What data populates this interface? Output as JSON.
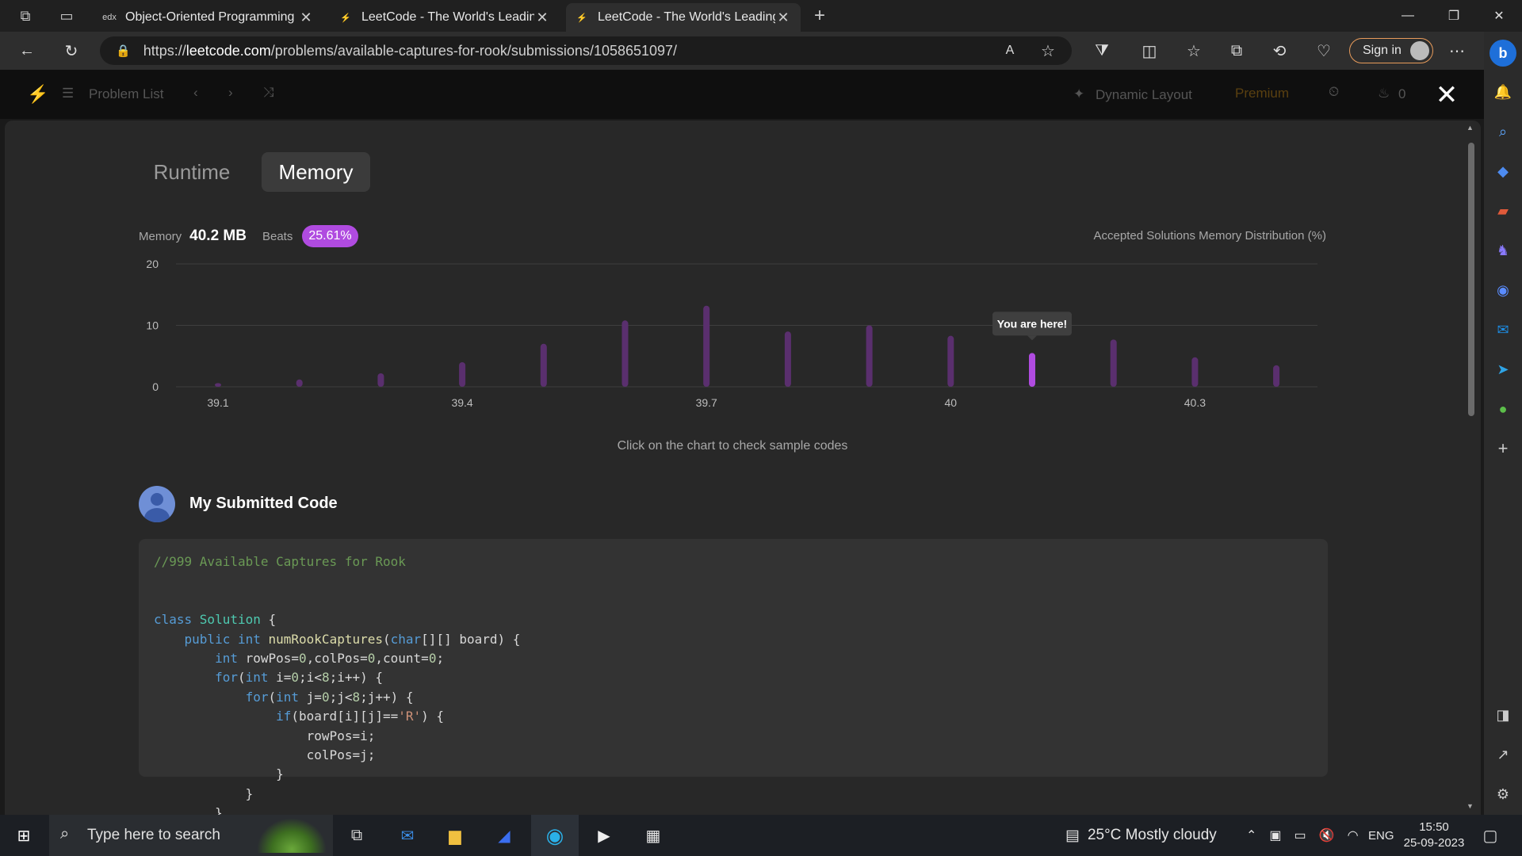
{
  "browser": {
    "tabs": [
      {
        "label": "Object-Oriented Programming |",
        "favicon": "edx"
      },
      {
        "label": "LeetCode - The World's Leading",
        "favicon": "leetcode-icon"
      },
      {
        "label": "LeetCode - The World's Leading",
        "favicon": "leetcode-icon"
      }
    ],
    "url_prefix": "https://",
    "url_host": "leetcode.com",
    "url_path": "/problems/available-captures-for-rook/submissions/1058651097/",
    "signin_label": "Sign in"
  },
  "lc_header": {
    "problem_list": "Problem List",
    "dynamic_layout": "Dynamic Layout",
    "premium": "Premium",
    "streak": "0"
  },
  "metric_tabs": {
    "runtime": "Runtime",
    "memory": "Memory"
  },
  "stats": {
    "memory_label": "Memory",
    "memory_value": "40.2 MB",
    "beats_label": "Beats",
    "beats_value": "25.61%",
    "distribution_title": "Accepted Solutions Memory Distribution (%)"
  },
  "chart_data": {
    "type": "bar",
    "title": "Accepted Solutions Memory Distribution (%)",
    "x_ticks": [
      "39.1",
      "39.4",
      "39.7",
      "40",
      "40.3"
    ],
    "y_ticks": [
      "0",
      "10",
      "20"
    ],
    "ylim": [
      0,
      20
    ],
    "x": [
      39.1,
      39.2,
      39.3,
      39.4,
      39.5,
      39.6,
      39.7,
      39.8,
      39.9,
      40.0,
      40.1,
      40.2,
      40.3,
      40.4
    ],
    "values": [
      0.6,
      1.2,
      2.2,
      4.0,
      7.0,
      10.8,
      13.2,
      9.0,
      10.0,
      8.3,
      5.5,
      7.7,
      4.8,
      3.5
    ],
    "highlight_index": 10,
    "tooltip": "You are here!",
    "bar_color": "#5a2f6e",
    "highlight_color": "#b04be0"
  },
  "hint": "Click on the chart to check sample codes",
  "submitted_title": "My Submitted Code",
  "code_lines": [
    [
      {
        "t": "//999 Available Captures for Rook",
        "c": "cmt"
      }
    ],
    [],
    [],
    [
      {
        "t": "class ",
        "c": "kw"
      },
      {
        "t": "Solution",
        "c": "cls"
      },
      {
        "t": " {",
        "c": ""
      }
    ],
    [
      {
        "t": "    public ",
        "c": "kw"
      },
      {
        "t": "int ",
        "c": "kw"
      },
      {
        "t": "numRookCaptures",
        "c": "fn"
      },
      {
        "t": "(",
        "c": ""
      },
      {
        "t": "char",
        "c": "kw"
      },
      {
        "t": "[][] board) {",
        "c": ""
      }
    ],
    [
      {
        "t": "        int ",
        "c": "kw"
      },
      {
        "t": "rowPos=",
        "c": ""
      },
      {
        "t": "0",
        "c": "num"
      },
      {
        "t": ",colPos=",
        "c": ""
      },
      {
        "t": "0",
        "c": "num"
      },
      {
        "t": ",count=",
        "c": ""
      },
      {
        "t": "0",
        "c": "num"
      },
      {
        "t": ";",
        "c": ""
      }
    ],
    [
      {
        "t": "        for",
        "c": "kw"
      },
      {
        "t": "(",
        "c": ""
      },
      {
        "t": "int ",
        "c": "kw"
      },
      {
        "t": "i=",
        "c": ""
      },
      {
        "t": "0",
        "c": "num"
      },
      {
        "t": ";i<",
        "c": ""
      },
      {
        "t": "8",
        "c": "num"
      },
      {
        "t": ";i++) {",
        "c": ""
      }
    ],
    [
      {
        "t": "            for",
        "c": "kw"
      },
      {
        "t": "(",
        "c": ""
      },
      {
        "t": "int ",
        "c": "kw"
      },
      {
        "t": "j=",
        "c": ""
      },
      {
        "t": "0",
        "c": "num"
      },
      {
        "t": ";j<",
        "c": ""
      },
      {
        "t": "8",
        "c": "num"
      },
      {
        "t": ";j++) {",
        "c": ""
      }
    ],
    [
      {
        "t": "                if",
        "c": "kw"
      },
      {
        "t": "(board[i][j]==",
        "c": ""
      },
      {
        "t": "'R'",
        "c": "str"
      },
      {
        "t": ") {",
        "c": ""
      }
    ],
    [
      {
        "t": "                    rowPos=i;",
        "c": ""
      }
    ],
    [
      {
        "t": "                    colPos=j;",
        "c": ""
      }
    ],
    [
      {
        "t": "                }",
        "c": ""
      }
    ],
    [
      {
        "t": "            }",
        "c": ""
      }
    ],
    [
      {
        "t": "        }",
        "c": ""
      }
    ]
  ],
  "taskbar": {
    "search_placeholder": "Type here to search",
    "weather": "25°C  Mostly cloudy",
    "lang": "ENG",
    "time": "15:50",
    "date": "25-09-2023"
  }
}
